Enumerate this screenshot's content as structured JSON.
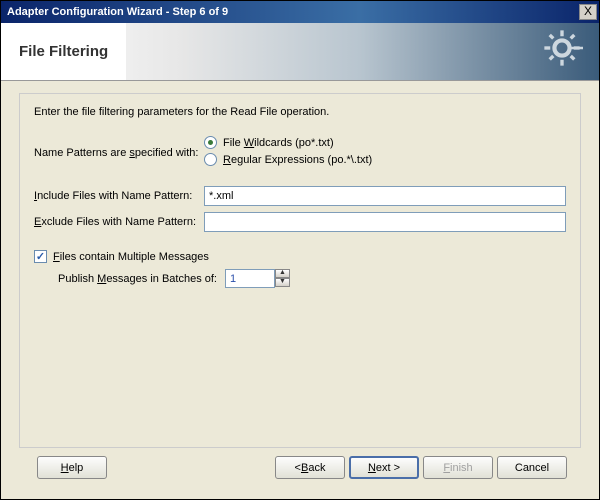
{
  "window": {
    "title": "Adapter Configuration Wizard - Step 6 of 9",
    "close_label": "X"
  },
  "header": {
    "title": "File Filtering"
  },
  "content": {
    "intro": "Enter the file filtering parameters for the Read File operation.",
    "name_patterns_label_pre": "Name Patterns are ",
    "name_patterns_label_u": "s",
    "name_patterns_label_post": "pecified with:",
    "radio_wildcards": {
      "pre": "File ",
      "u": "W",
      "post": "ildcards (po*.txt)",
      "checked": true
    },
    "radio_regex": {
      "u": "R",
      "post": "egular Expressions (po.*\\.txt)",
      "checked": false
    },
    "include_label": {
      "u": "I",
      "post": "nclude Files with Name Pattern:"
    },
    "include_value": "*.xml",
    "exclude_label": {
      "u": "E",
      "post": "xclude Files with Name Pattern:"
    },
    "exclude_value": "",
    "files_multiple": {
      "u": "F",
      "post": "iles contain Multiple Messages",
      "checked": true
    },
    "publish_label": {
      "pre": "Publish ",
      "u": "M",
      "post": "essages in Batches of:"
    },
    "publish_value": "1"
  },
  "footer": {
    "help": {
      "u": "H",
      "post": "elp"
    },
    "back": {
      "pre": "< ",
      "u": "B",
      "post": "ack"
    },
    "next": {
      "u": "N",
      "post": "ext >"
    },
    "finish": {
      "u": "F",
      "post": "inish"
    },
    "cancel": "Cancel"
  }
}
